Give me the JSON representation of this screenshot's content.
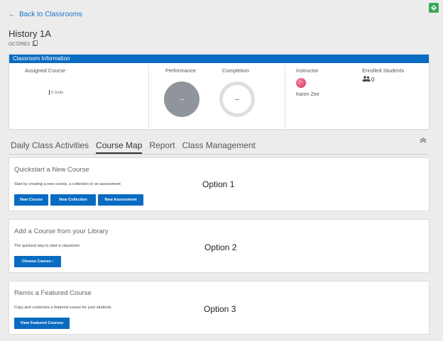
{
  "nav": {
    "back_label": "Back to Classrooms"
  },
  "classroom": {
    "title": "History 1A",
    "code": "OC7ZRE2"
  },
  "info": {
    "header": "Classroom Information",
    "assigned_course_label": "Assigned Course",
    "units_text": "0 Units",
    "performance_label": "Performance",
    "performance_value": "--",
    "completion_label": "Completion",
    "completion_value": "--",
    "instructor_label": "Instructor",
    "instructor_name": "Karen Zee",
    "enrolled_label": "Enrolled Students",
    "enrolled_count": "0"
  },
  "tabs": [
    {
      "label": "Daily Class Activities"
    },
    {
      "label": "Course Map",
      "active": true
    },
    {
      "label": "Report"
    },
    {
      "label": "Class Management"
    }
  ],
  "cards": {
    "quickstart": {
      "title": "Quickstart a New Course",
      "desc": "Start by creating a new course, a collection or an assessment",
      "buttons": [
        "New Course",
        "New Collection",
        "New Assessment"
      ],
      "option_label": "Option 1"
    },
    "library": {
      "title": "Add a Course from your Library",
      "desc": "The quickest way to start a classroom",
      "button": "Choose Course ›",
      "option_label": "Option 2"
    },
    "featured": {
      "title": "Remix a Featured Course",
      "desc": "Copy and customize a featured course for your students",
      "button": "View Featured Courses",
      "option_label": "Option 3"
    }
  },
  "colors": {
    "primary": "#0a6bc2",
    "background": "#ececec",
    "accent_green": "#3aa85a"
  }
}
